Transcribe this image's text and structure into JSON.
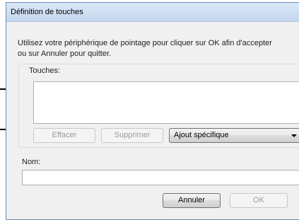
{
  "dialog": {
    "title": "Définition de touches",
    "instructions_line1": "Utilisez votre périphérique de pointage pour cliquer sur OK afin d'accepter",
    "instructions_line2": "ou sur Annuler pour quitter."
  },
  "keys_group": {
    "label": "Touches:",
    "erase_label": "Effacer",
    "delete_label": "Supprimer",
    "combo_value": "Ajout spécifique"
  },
  "name_field": {
    "label": "Nom:",
    "value": ""
  },
  "footer": {
    "cancel_label": "Annuler",
    "ok_label": "OK"
  },
  "colors": {
    "title_bar": "#c4d7ef",
    "dialog_bg": "#f0f0f0",
    "disabled_text": "#9a9a9a"
  }
}
